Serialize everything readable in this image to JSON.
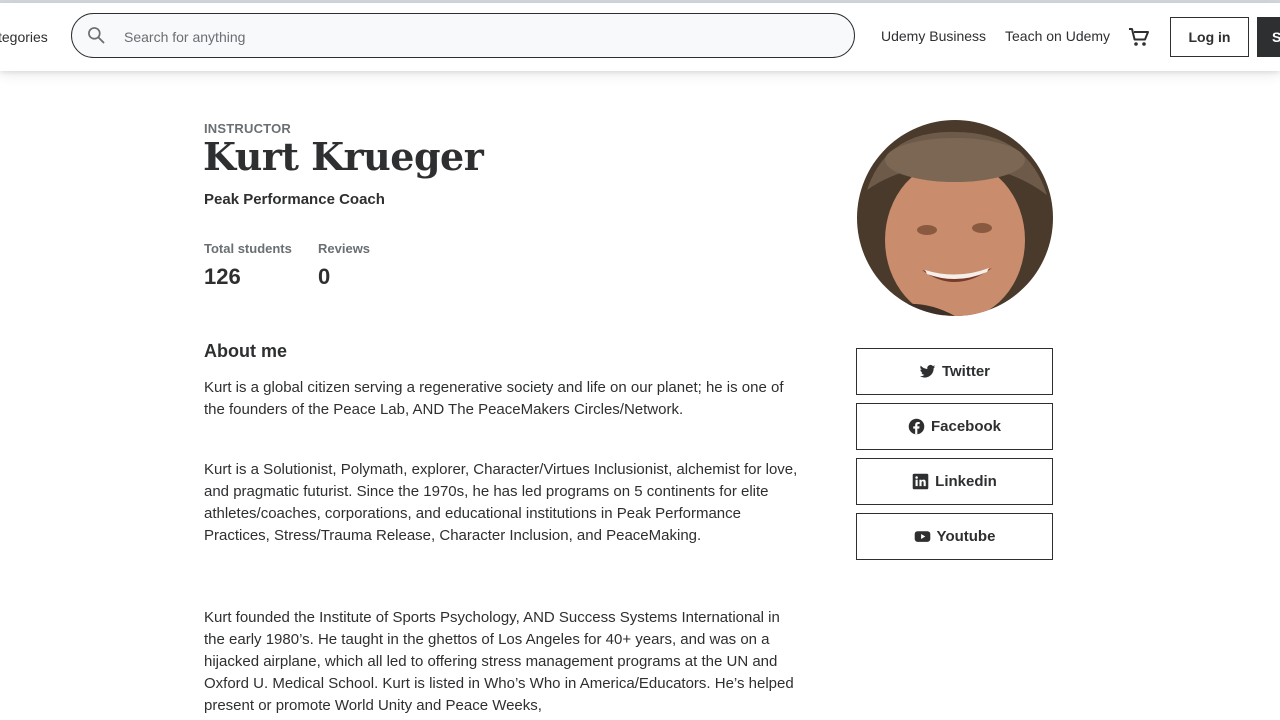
{
  "header": {
    "categories_label": "tegories",
    "search_placeholder": "Search for anything",
    "business_link": "Udemy Business",
    "teach_link": "Teach on Udemy",
    "login_label": "Log in",
    "signup_label": "S"
  },
  "profile": {
    "eyebrow": "INSTRUCTOR",
    "name": "Kurt Krueger",
    "headline": "Peak Performance Coach",
    "stats": [
      {
        "label": "Total students",
        "value": "126"
      },
      {
        "label": "Reviews",
        "value": "0"
      }
    ]
  },
  "about": {
    "title": "About me",
    "paragraphs": [
      "Kurt is a global citizen serving a regenerative society and life on our planet; he is one of the founders of the Peace Lab, AND The PeaceMakers Circles/Network.",
      "Kurt is a Solutionist, Polymath, explorer, Character/Virtues Inclusionist, alchemist for love, and pragmatic futurist. Since the 1970s, he has led programs on 5 continents for elite athletes/coaches, corporations, and educational institutions in Peak Performance Practices, Stress/Trauma Release, Character Inclusion, and PeaceMaking.",
      "Kurt founded the Institute of Sports Psychology, AND Success Systems International in the early 1980’s. He taught in the ghettos of Los Angeles for 40+ years, and was on a hijacked airplane, which all led to offering stress management programs at the UN and Oxford U. Medical School. Kurt is listed in Who’s Who in America/Educators. He’s helped present or promote World Unity and Peace Weeks,"
    ]
  },
  "social_links": [
    {
      "label": "Twitter",
      "icon": "twitter-icon"
    },
    {
      "label": "Facebook",
      "icon": "facebook-icon"
    },
    {
      "label": "Linkedin",
      "icon": "linkedin-icon"
    },
    {
      "label": "Youtube",
      "icon": "youtube-icon"
    }
  ]
}
